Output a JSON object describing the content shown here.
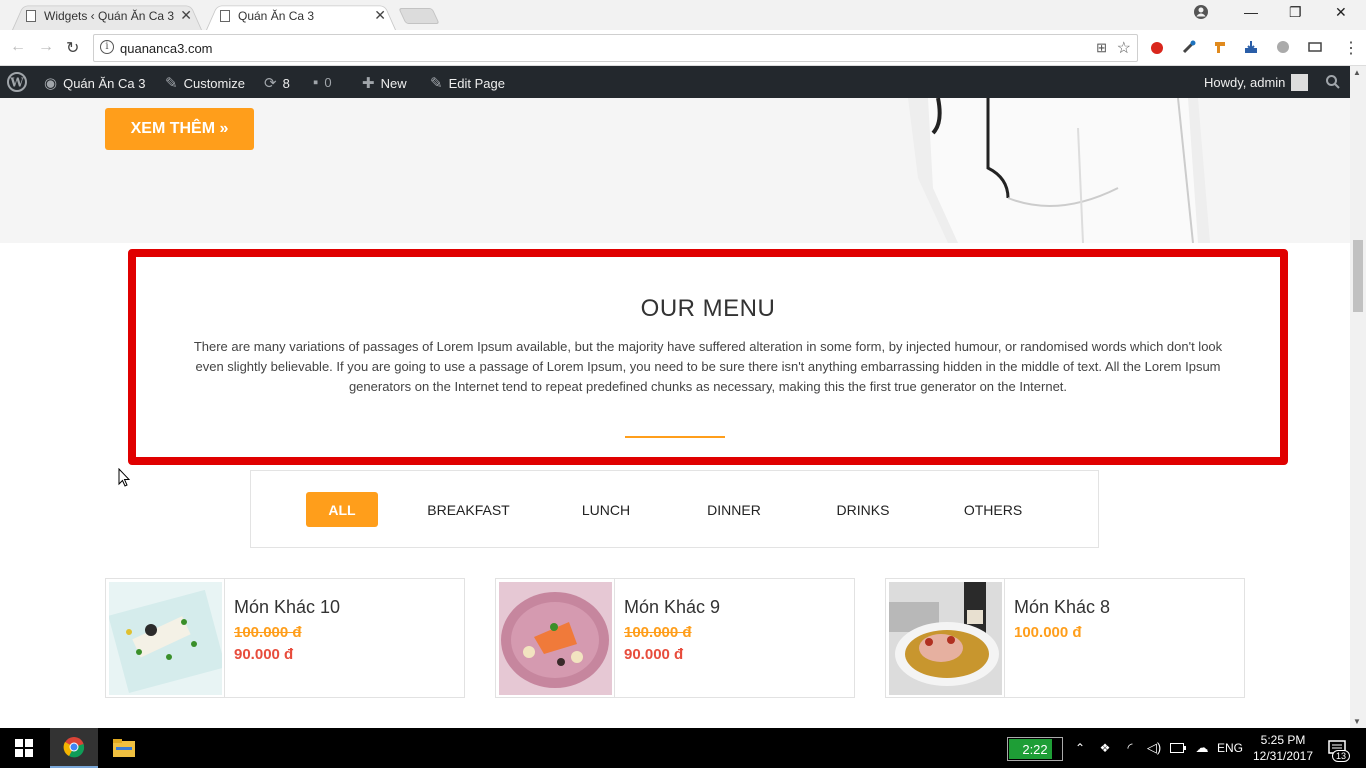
{
  "browser": {
    "tabs": [
      {
        "title": "Widgets ‹ Quán Ăn Ca 3",
        "active": false
      },
      {
        "title": "Quán Ăn Ca 3",
        "active": true
      }
    ],
    "url": "quananca3.com"
  },
  "admin_bar": {
    "site_name": "Quán Ăn Ca 3",
    "customize": "Customize",
    "updates_count": "8",
    "comments_count": "0",
    "new_label": "New",
    "edit_page": "Edit Page",
    "howdy": "Howdy, admin"
  },
  "hero": {
    "button_label": "XEM THÊM  »"
  },
  "menu_section": {
    "title": "OUR MENU",
    "description": "There are many variations of passages of Lorem Ipsum available, but the majority have suffered alteration in some form, by injected humour, or randomised words which don't look even slightly believable. If you are going to use a passage of Lorem Ipsum, you need to be sure there isn't anything embarrassing hidden in the middle of text. All the Lorem Ipsum generators on the Internet tend to repeat predefined chunks as necessary, making this the first true generator on the Internet."
  },
  "filters": [
    "ALL",
    "BREAKFAST",
    "LUNCH",
    "DINNER",
    "DRINKS",
    "OTHERS"
  ],
  "active_filter": "ALL",
  "items": [
    {
      "name": "Món Khác 10",
      "old_price": "100.000 đ",
      "price": "90.000 đ"
    },
    {
      "name": "Món Khác 9",
      "old_price": "100.000 đ",
      "price": "90.000 đ"
    },
    {
      "name": "Món Khác 8",
      "price": "100.000 đ"
    }
  ],
  "taskbar": {
    "battery_time": "2:22",
    "language": "ENG",
    "time": "5:25 PM",
    "date": "12/31/2017",
    "notifications": "13"
  },
  "colors": {
    "accent": "#ff9e1b",
    "highlight_border": "#e00000",
    "sale_price": "#e74c3c",
    "admin_bar": "#23282d"
  }
}
